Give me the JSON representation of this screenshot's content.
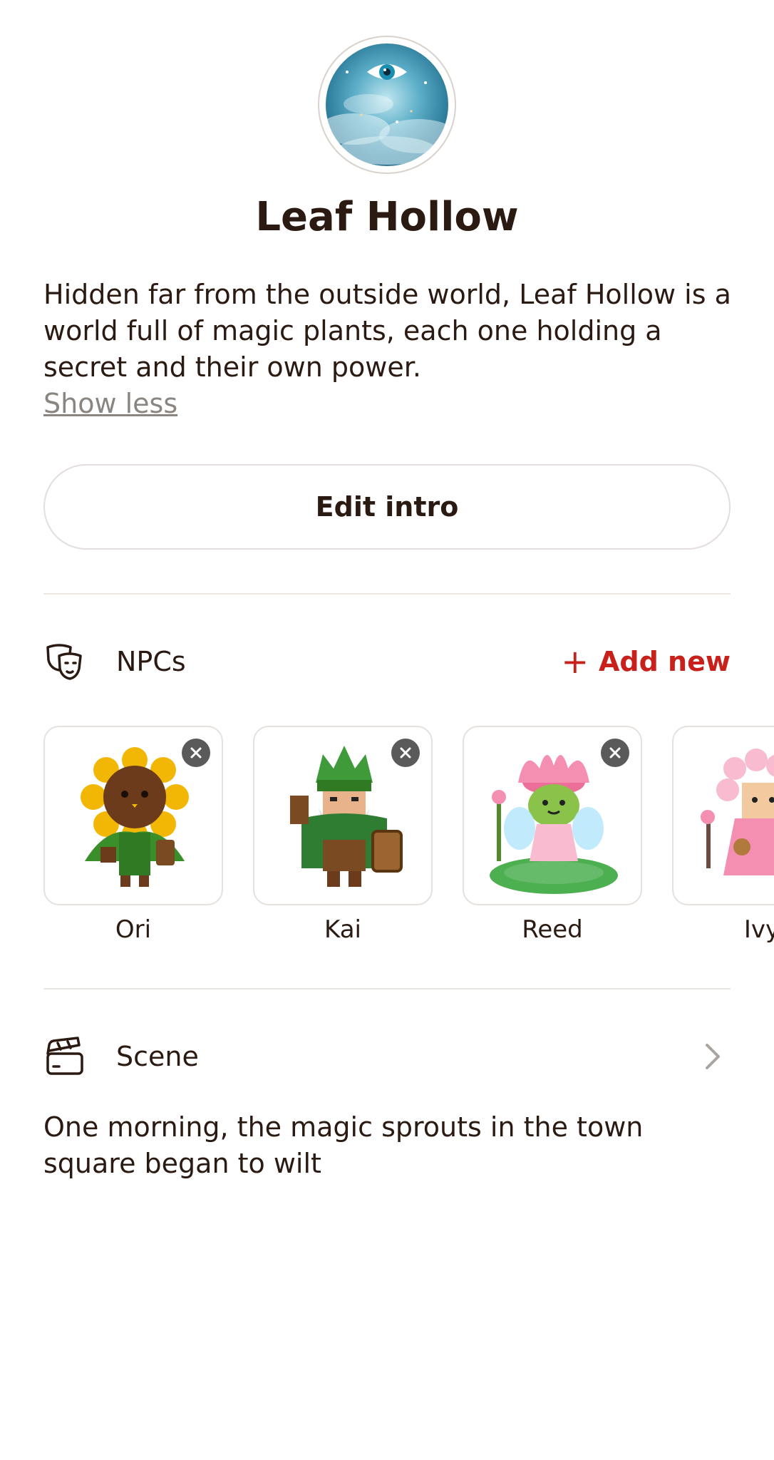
{
  "world": {
    "title": "Leaf Hollow",
    "description": "Hidden far from the outside world, Leaf Hollow is a world full of magic plants, each one holding a secret and their own power.",
    "show_less": "Show less",
    "avatar_icon": "eye-cloud-image"
  },
  "actions": {
    "edit_intro": "Edit intro"
  },
  "npcs": {
    "label": "NPCs",
    "icon": "theater-masks-icon",
    "add_new": "Add new",
    "accent": "#c8201b",
    "items": [
      {
        "name": "Ori",
        "image": "sunflower-character"
      },
      {
        "name": "Kai",
        "image": "leaf-dwarf-character"
      },
      {
        "name": "Reed",
        "image": "lotus-fairy-character"
      },
      {
        "name": "Ivy",
        "image": "blossom-girl-character"
      }
    ]
  },
  "scene": {
    "label": "Scene",
    "icon": "clapperboard-icon",
    "text": "One morning, the magic sprouts in the town square began to wilt"
  }
}
